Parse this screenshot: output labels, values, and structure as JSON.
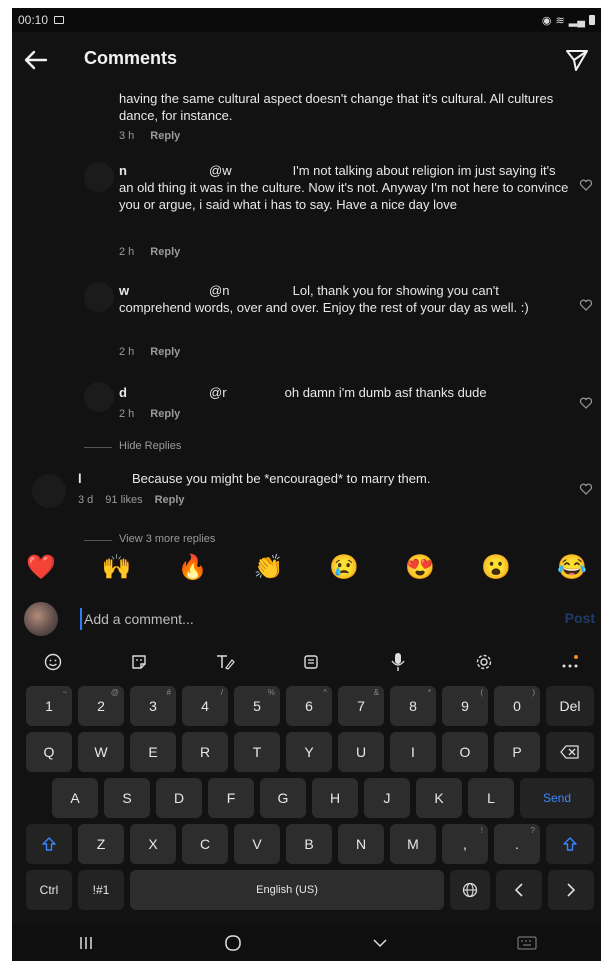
{
  "status_bar": {
    "time": "00:10"
  },
  "header": {
    "title": "Comments"
  },
  "comments": [
    {
      "text": "having the same cultural aspect doesn't change that it's cultural. All cultures dance, for instance.",
      "time": "3 h",
      "reply": "Reply"
    },
    {
      "user": "n",
      "mention": "@w",
      "text": "I'm not talking about religion im just saying it's an old thing it was in the culture. Now it's not. Anyway I'm not here to convince you or argue, i said what i has to say. Have a nice day love",
      "time": "2 h",
      "reply": "Reply"
    },
    {
      "user": "w",
      "mention": "@n",
      "text": "Lol, thank you for showing you can't comprehend words, over and over. Enjoy the rest of your day as well. :)",
      "time": "2 h",
      "reply": "Reply"
    },
    {
      "user": "d",
      "mention": "@r",
      "text": "oh damn i'm dumb asf thanks dude",
      "time": "2 h",
      "reply": "Reply"
    },
    {
      "user": "l",
      "text": "Because you might be *encouraged* to marry them.",
      "time": "3 d",
      "likes": "91 likes",
      "reply": "Reply"
    }
  ],
  "hide_replies": "Hide Replies",
  "view_more_replies": "View 3 more replies",
  "emojis": [
    "❤️",
    "🙌",
    "🔥",
    "👏",
    "😢",
    "😍",
    "😮",
    "😂"
  ],
  "input": {
    "placeholder": "Add a comment...",
    "post_label": "Post"
  },
  "keyboard": {
    "number_row": [
      {
        "k": "1",
        "s": "~"
      },
      {
        "k": "2",
        "s": "@"
      },
      {
        "k": "3",
        "s": "#"
      },
      {
        "k": "4",
        "s": "/"
      },
      {
        "k": "5",
        "s": "%"
      },
      {
        "k": "6",
        "s": "^"
      },
      {
        "k": "7",
        "s": "&"
      },
      {
        "k": "8",
        "s": "*"
      },
      {
        "k": "9",
        "s": "("
      },
      {
        "k": "0",
        "s": ")"
      }
    ],
    "del": "Del",
    "row1": [
      "Q",
      "W",
      "E",
      "R",
      "T",
      "Y",
      "U",
      "I",
      "O",
      "P"
    ],
    "row2": [
      "A",
      "S",
      "D",
      "F",
      "G",
      "H",
      "J",
      "K",
      "L"
    ],
    "send": "Send",
    "row3": [
      "Z",
      "X",
      "C",
      "V",
      "B",
      "N",
      "M"
    ],
    "comma": ",",
    "comma_sup": "!",
    "period": ".",
    "period_sup": "?",
    "ctrl": "Ctrl",
    "symbols": "!#1",
    "space": "English (US)"
  },
  "colors": {
    "accent": "#3b86ff",
    "background": "#121212",
    "key": "#2d2d2d"
  }
}
